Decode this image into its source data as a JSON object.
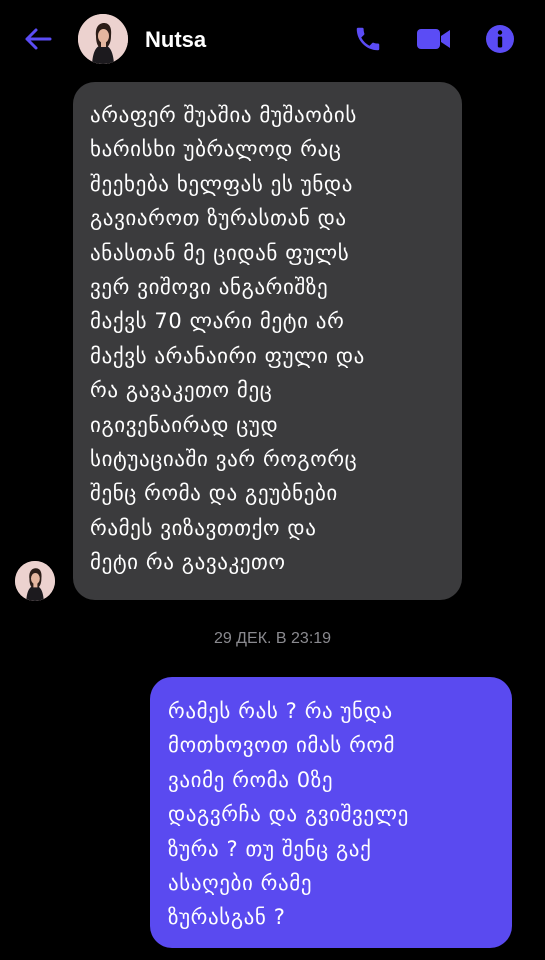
{
  "header": {
    "contact_name": "Nutsa",
    "back_icon": "arrow-left-icon",
    "call_icon": "phone-icon",
    "video_icon": "video-camera-icon",
    "info_icon": "info-icon",
    "accent_color": "#5b4cf5"
  },
  "messages": [
    {
      "direction": "incoming",
      "sender": "Nutsa",
      "lines": [
        "არაფერ შუაშია მუშაობის",
        "ხარისხი უბრალოდ რაც",
        "შეეხება ხელფას ეს უნდა",
        "გავიაროთ ზურასთან და",
        "ანასთან მე ციდან ფულს",
        "ვერ ვიშოვი ანგარიშზე",
        "მაქვს 70 ლარი მეტი არ",
        "მაქვს არანაირი ფული და",
        "რა გავაკეთო მეც",
        "იგივენაირად ცუდ",
        "სიტუაციაში ვარ როგორც",
        "შენც რომა და გეუბნები",
        "რამეს ვიზავთთქო და",
        "მეტი რა გავაკეთო"
      ]
    },
    {
      "direction": "outgoing",
      "lines": [
        "რამეს რას ? რა უნდა",
        "მოთხოვოთ იმას რომ",
        "ვაიმე რომა 0ზე",
        "დაგვრჩა და გვიშველე",
        "ზურა ? თუ შენც გაქ",
        "ასაღები რამე",
        "ზურასგან ?"
      ]
    }
  ],
  "timestamp": "29 ДЕК. В 23:19",
  "colors": {
    "background": "#000000",
    "incoming_bubble": "#3b3b3d",
    "outgoing_bubble": "#5a4af0",
    "timestamp_text": "#8a8a8f"
  }
}
